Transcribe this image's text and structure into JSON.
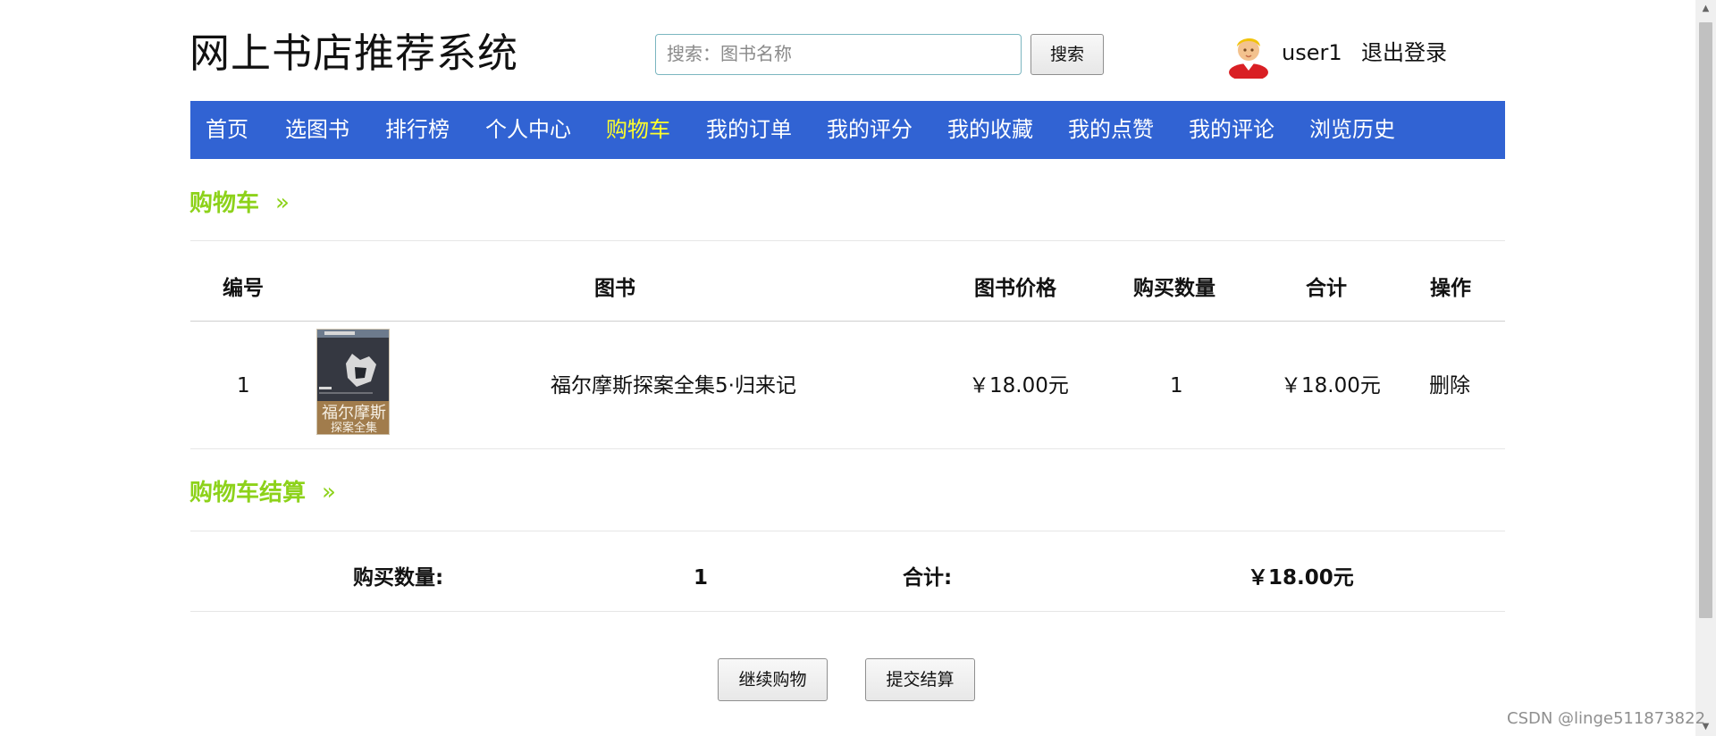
{
  "header": {
    "site_title": "网上书店推荐系统",
    "search_placeholder": "搜索：图书名称",
    "search_button": "搜索",
    "username": "user1",
    "logout": "退出登录"
  },
  "nav": {
    "items": [
      {
        "label": "首页",
        "active": false
      },
      {
        "label": "选图书",
        "active": false
      },
      {
        "label": "排行榜",
        "active": false
      },
      {
        "label": "个人中心",
        "active": false
      },
      {
        "label": "购物车",
        "active": true
      },
      {
        "label": "我的订单",
        "active": false
      },
      {
        "label": "我的评分",
        "active": false
      },
      {
        "label": "我的收藏",
        "active": false
      },
      {
        "label": "我的点赞",
        "active": false
      },
      {
        "label": "我的评论",
        "active": false
      },
      {
        "label": "浏览历史",
        "active": false
      }
    ]
  },
  "cart": {
    "section_title": "购物车",
    "arrow": "»",
    "columns": [
      "编号",
      "图书",
      "图书价格",
      "购买数量",
      "合计",
      "操作"
    ],
    "rows": [
      {
        "id": "1",
        "book_name": "福尔摩斯探案全集5·归来记",
        "price": "￥18.00元",
        "quantity": "1",
        "total": "￥18.00元",
        "action": "删除"
      }
    ],
    "cover_text": "福尔摩斯\n探案全集"
  },
  "checkout": {
    "section_title": "购物车结算",
    "arrow": "»",
    "quantity_label": "购买数量:",
    "quantity_value": "1",
    "total_label": "合计:",
    "total_value": "￥18.00元"
  },
  "actions": {
    "continue_shopping": "继续购物",
    "submit_checkout": "提交结算"
  },
  "watermark": "CSDN @linge511873822",
  "colors": {
    "nav_bg": "#3163d3",
    "nav_text": "#ffffff",
    "nav_active": "#ffff2b",
    "section_title": "#8dd21a",
    "border": "#e6e6e6"
  }
}
